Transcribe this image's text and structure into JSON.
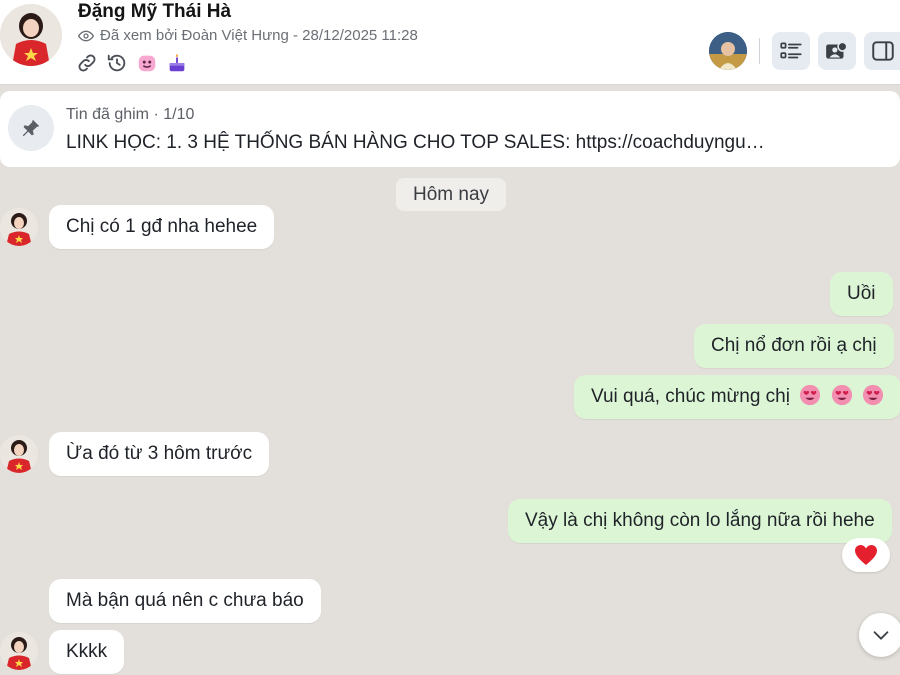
{
  "header": {
    "contact_name": "Đặng Mỹ Thái Hà",
    "seen_text": "Đã xem bởi Đoàn Việt Hưng - 28/12/2025 11:28",
    "icons": [
      "link-icon",
      "history-icon",
      "sticker-icon",
      "cake-icon"
    ],
    "tools": [
      "conversation-info-icon",
      "group-icon",
      "sidebar-toggle-icon"
    ]
  },
  "pinned": {
    "title": "Tin đã ghim · 1/10",
    "text": "LINK HỌC: 1. 3 HỆ THỐNG BÁN HÀNG CHO TOP SALES: https://coachduyngu…"
  },
  "date_separator": "Hôm nay",
  "messages": [
    {
      "side": "in",
      "text": "Chị có 1 gđ nha hehee"
    },
    {
      "side": "out",
      "text": "Uồi"
    },
    {
      "side": "out",
      "text": "Chị nổ đơn rồi ạ chị"
    },
    {
      "side": "out",
      "text": "Vui quá, chúc mừng chị",
      "emoji": [
        "heart-eyes-emoji",
        "heart-eyes-emoji",
        "heart-eyes-emoji"
      ]
    },
    {
      "side": "in",
      "text": "Ừa đó từ 3 hôm trước"
    },
    {
      "side": "out",
      "text": "Vậy là chị không còn lo lắng nữa rồi hehe",
      "reaction": "heart-icon"
    },
    {
      "side": "in",
      "text": "Mà bận quá nên c chưa báo"
    },
    {
      "side": "in",
      "text": "Kkkk"
    }
  ],
  "colors": {
    "incoming_bubble": "#ffffff",
    "outgoing_bubble": "#dcf6d5",
    "chat_background": "#e3dfda",
    "reaction_heart": "#e5202e"
  }
}
